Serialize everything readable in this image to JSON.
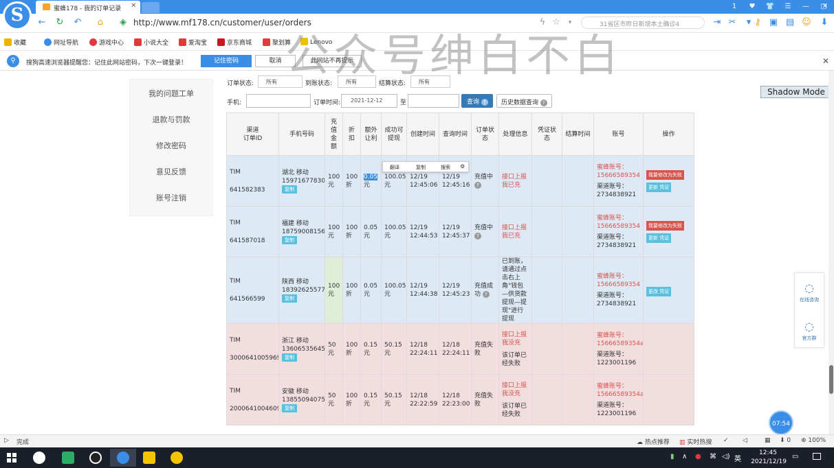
{
  "browser": {
    "tab_title": "蜜蜂178 - 我的订单记录",
    "url": "http://www.mf178.cn/customer/user/orders",
    "search_placeholder": "31省区市昨日新增本土确诊4",
    "window_controls": [
      "1",
      "♥",
      "👕",
      "☰",
      "—",
      "▢",
      "✕"
    ]
  },
  "bookmarks": [
    {
      "label": "收藏",
      "color": "#f0b400"
    },
    {
      "label": "网址导航",
      "color": "#3b8ee8"
    },
    {
      "label": "游戏中心",
      "color": "#e4393c"
    },
    {
      "label": "小说大全",
      "color": "#e4393c"
    },
    {
      "label": "爱淘宝",
      "color": "#e4393c"
    },
    {
      "label": "京东商城",
      "color": "#c81623"
    },
    {
      "label": "聚划算",
      "color": "#e4393c"
    },
    {
      "label": "Lenovo",
      "color": "#f0c000"
    }
  ],
  "password_bar": {
    "message": "搜狗高速浏览器提醒您：记住此网站密码，下次一键登录！",
    "save_label": "记住密码",
    "cancel_label": "取消",
    "never_label": "此网站不再提示"
  },
  "watermark": "公众号绅白不白",
  "shadow_mode": "Shadow Mode",
  "sidebar": {
    "items": [
      "我的问题工单",
      "退款与罚款",
      "修改密码",
      "意见反馈",
      "账号注销"
    ]
  },
  "filters": {
    "order_status_label": "订单状态:",
    "order_status_value": "所有",
    "account_status_label": "到账状态:",
    "account_status_value": "所有",
    "settle_status_label": "结算状态:",
    "settle_status_value": "所有",
    "phone_label": "手机:",
    "phone_value": "",
    "time_label": "订单时间:",
    "time_from": "2021-12-12",
    "to_label": "至",
    "time_to": "",
    "query_label": "查询",
    "history_label": "历史数据查询"
  },
  "table": {
    "headers": [
      "渠道\n订单ID",
      "手机号码",
      "充值金额",
      "折扣",
      "额外让利",
      "成功可提现",
      "创建时间",
      "查询时间",
      "订单状态",
      "处理信息",
      "凭证状态",
      "结算时间",
      "账号",
      "操作"
    ],
    "copy_label": "复制",
    "bee_account_label": "蜜蜂账号：",
    "channel_account_label": "渠道账号：",
    "rows": [
      {
        "style": "blue",
        "channel": "TIM",
        "order_id": "641582383",
        "region": "湖北 移动",
        "phone": "15971677830",
        "amount": "100元",
        "discount": "100折",
        "extra": "0.05",
        "extra_unit": "元",
        "withdraw": "100.05元",
        "created": "12/19 12:45:06",
        "queried": "12/19 12:45:16",
        "status": "充值中",
        "info1": "接口上报我已充",
        "info2": "",
        "bee": "15666589354",
        "channel_acct": "2734838921",
        "red_btn": "我要修改为失败",
        "blue_btn": "更新 凭证"
      },
      {
        "style": "blue",
        "channel": "TIM",
        "order_id": "641587018",
        "region": "福建 移动",
        "phone": "18759008156",
        "amount": "100元",
        "discount": "100折",
        "extra": "0.05",
        "extra_unit": "元",
        "withdraw": "100.05元",
        "created": "12/19 12:44:53",
        "queried": "12/19 12:45:37",
        "status": "充值中",
        "info1": "接口上报我已充",
        "info2": "",
        "bee": "15666589354",
        "channel_acct": "2734838921",
        "red_btn": "我要修改为失败",
        "blue_btn": "更新 凭证"
      },
      {
        "style": "blue",
        "channel": "TIM",
        "order_id": "641566599",
        "region": "陕西 移动",
        "phone": "18392625577",
        "amount": "100元",
        "discount": "100折",
        "extra": "0.05",
        "extra_unit": "元",
        "withdraw": "100.05元",
        "created": "12/19 12:44:38",
        "queried": "12/19 12:45:23",
        "status": "充值成功",
        "info1": "已到账，请通过点击右上角\"钱包—供货款提现—提现\"进行提现",
        "info2": "",
        "bee": "15666589354",
        "channel_acct": "2734838921",
        "red_btn": "",
        "blue_btn": "更改 凭证"
      },
      {
        "style": "pink",
        "channel": "TIM",
        "order_id": "3000641005969",
        "region": "浙江 移动",
        "phone": "13606535645",
        "amount": "50元",
        "discount": "100折",
        "extra": "0.15",
        "extra_unit": "元",
        "withdraw": "50.15元",
        "created": "12/18 22:24:11",
        "queried": "12/18 22:24:11",
        "status": "充值失败",
        "info1": "接口上报我没充",
        "info2": "该订单已经失败",
        "bee": "15666589354a",
        "channel_acct": "1223001196",
        "red_btn": "",
        "blue_btn": ""
      },
      {
        "style": "pink",
        "channel": "TIM",
        "order_id": "2000641004609",
        "region": "安徽 移动",
        "phone": "13855094075",
        "amount": "50元",
        "discount": "100折",
        "extra": "0.15",
        "extra_unit": "元",
        "withdraw": "50.15元",
        "created": "12/18 22:22:59",
        "queried": "12/18 22:23:00",
        "status": "充值失败",
        "info1": "接口上报我没充",
        "info2": "该订单已经失败",
        "bee": "15666589354a",
        "channel_acct": "1223001196",
        "red_btn": "",
        "blue_btn": ""
      }
    ]
  },
  "popup": {
    "translate": "翻译",
    "copy": "复制",
    "search": "搜索"
  },
  "float_panel": {
    "online": "在线咨询",
    "group": "官方群"
  },
  "clock_badge": "07:54",
  "statusbar": {
    "left": "完成",
    "hot_recommend": "热点推荐",
    "live_hot": "实时热搜",
    "download_count": "0",
    "zoom": "100%"
  },
  "taskbar": {
    "ime": "英",
    "time": "12:45",
    "date": "2021/12/19"
  }
}
